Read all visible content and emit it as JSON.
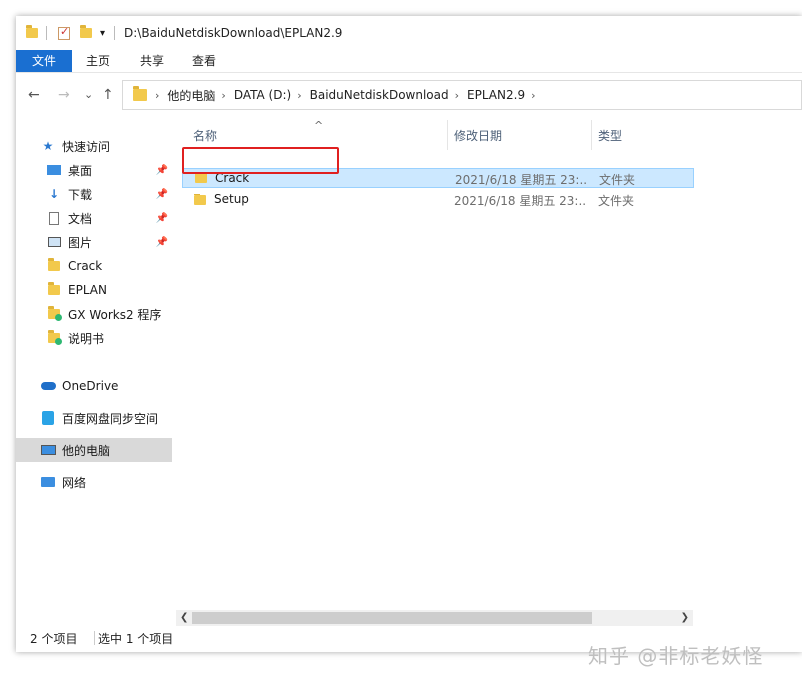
{
  "window": {
    "title_path": "D:\\BaiduNetdiskDownload\\EPLAN2.9"
  },
  "ribbon": {
    "tabs": [
      {
        "label": "文件"
      },
      {
        "label": "主页"
      },
      {
        "label": "共享"
      },
      {
        "label": "查看"
      }
    ]
  },
  "nav": {
    "back": "←",
    "forward": "→",
    "recent": "⌄",
    "up": "↑"
  },
  "address": {
    "crumbs": [
      "他的电脑",
      "DATA (D:)",
      "BaiduNetdiskDownload",
      "EPLAN2.9"
    ]
  },
  "sidebar": {
    "items": [
      {
        "label": "快速访问",
        "icon": "star-icon"
      },
      {
        "label": "桌面",
        "icon": "desktop-icon",
        "pinned": true
      },
      {
        "label": "下载",
        "icon": "download-icon",
        "pinned": true
      },
      {
        "label": "文档",
        "icon": "document-icon",
        "pinned": true
      },
      {
        "label": "图片",
        "icon": "picture-icon",
        "pinned": true
      },
      {
        "label": "Crack",
        "icon": "folder-icon"
      },
      {
        "label": "EPLAN",
        "icon": "folder-icon"
      },
      {
        "label": "GX Works2 程序",
        "icon": "folder-sync-icon"
      },
      {
        "label": "说明书",
        "icon": "folder-sync-icon"
      },
      {
        "label": "OneDrive",
        "icon": "cloud-icon"
      },
      {
        "label": "百度网盘同步空间",
        "icon": "baidu-icon"
      },
      {
        "label": "他的电脑",
        "icon": "computer-icon",
        "selected": true
      },
      {
        "label": "网络",
        "icon": "network-icon"
      }
    ]
  },
  "table": {
    "sort_indicator": "^",
    "columns": [
      "名称",
      "修改日期",
      "类型"
    ],
    "rows": [
      {
        "name": "Crack",
        "date": "2021/6/18 星期五 23:...",
        "type": "文件夹",
        "selected": true
      },
      {
        "name": "Setup",
        "date": "2021/6/18 星期五 23:...",
        "type": "文件夹",
        "selected": false
      }
    ]
  },
  "status": {
    "count": "2 个项目",
    "selection": "选中 1 个项目"
  },
  "watermark": "知乎 @非标老妖怪",
  "colors": {
    "accent": "#1a6fd1",
    "selection": "#cce8ff",
    "highlight_box": "#e02020",
    "folder": "#f2c94c"
  }
}
